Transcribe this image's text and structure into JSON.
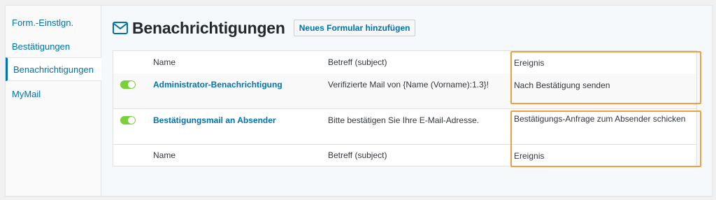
{
  "sidebar": {
    "items": [
      {
        "label": "Form.-Einstlgn."
      },
      {
        "label": "Bestätigungen"
      },
      {
        "label": "Benachrichtigungen"
      },
      {
        "label": "MyMail"
      }
    ]
  },
  "header": {
    "title": "Benachrichtigungen",
    "add_button": "Neues Formular hinzufügen",
    "icon": "envelope-icon"
  },
  "table": {
    "columns": {
      "name": "Name",
      "subject": "Betreff (subject)",
      "event": "Ereignis"
    },
    "rows": [
      {
        "enabled": true,
        "name": "Administrator-Benachrichtigung",
        "subject": "Verifizierte Mail von {Name (Vorname):1.3}!",
        "event": "Nach Bestätigung senden"
      },
      {
        "enabled": true,
        "name": "Bestätigungsmail an Absender",
        "subject": "Bitte bestätigen Sie Ihre E-Mail-Adresse.",
        "event": "Bestätigungs-Anfrage zum Absender schicken"
      }
    ]
  },
  "colors": {
    "accent": "#0073aa",
    "toggle_on": "#7ad03a",
    "highlight": "#f0a040"
  }
}
